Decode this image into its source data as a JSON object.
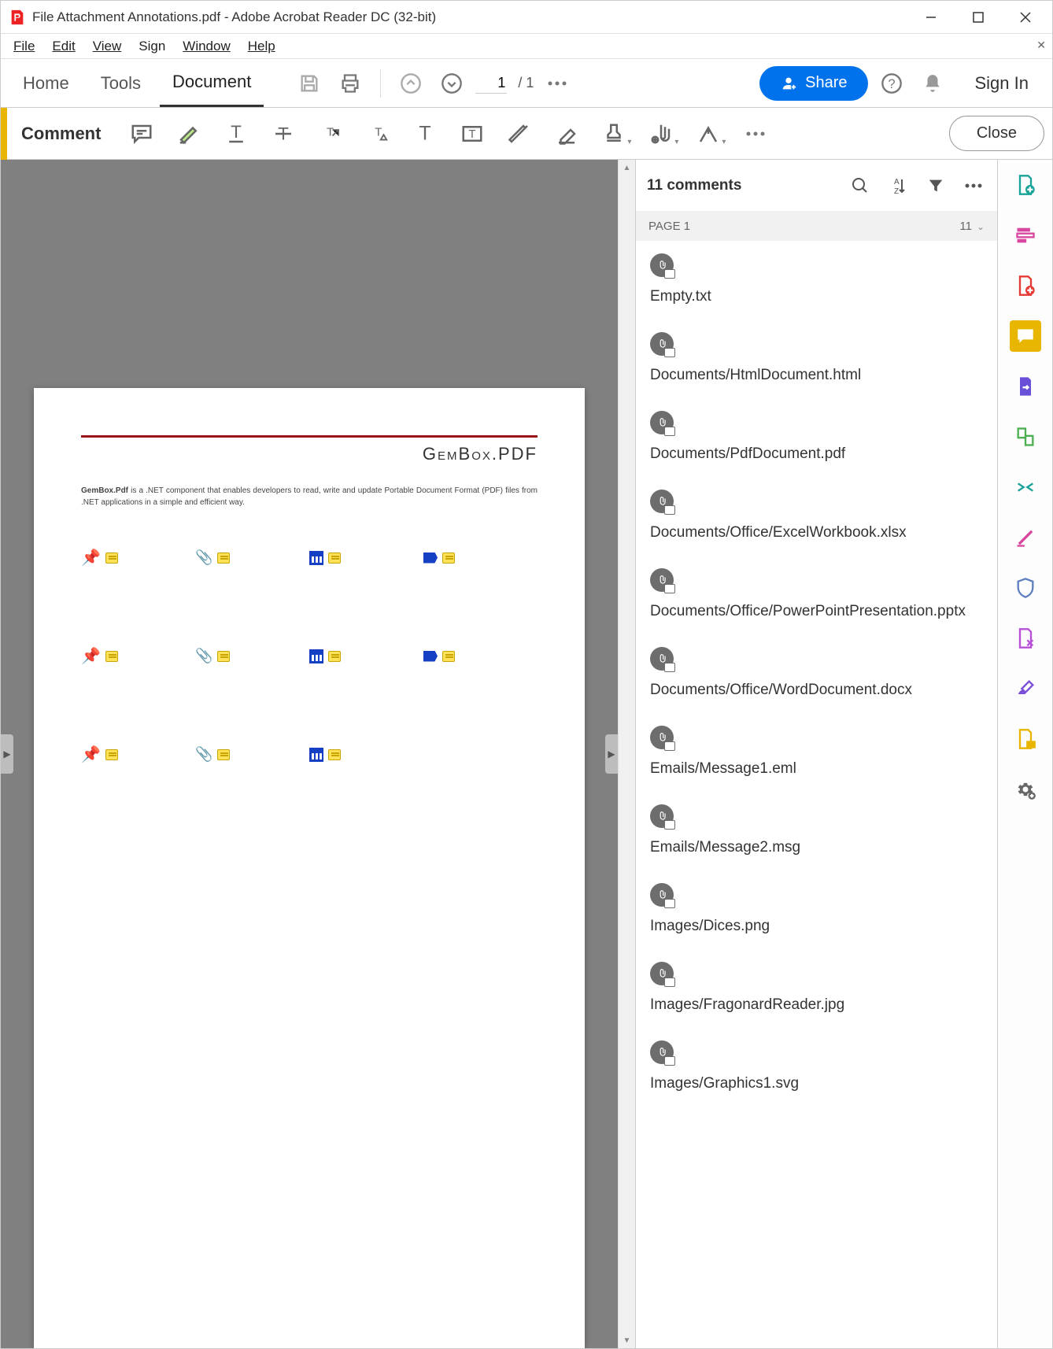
{
  "window": {
    "title": "File Attachment Annotations.pdf - Adobe Acrobat Reader DC (32-bit)"
  },
  "menu": {
    "file": "File",
    "edit": "Edit",
    "view": "View",
    "sign": "Sign",
    "window": "Window",
    "help": "Help"
  },
  "tabs": {
    "home": "Home",
    "tools": "Tools",
    "document": "Document"
  },
  "paging": {
    "current": "1",
    "sep": "/",
    "total": "1"
  },
  "toolbar": {
    "share": "Share",
    "signin": "Sign In"
  },
  "comment_bar": {
    "label": "Comment",
    "close": "Close"
  },
  "comments": {
    "header": "11 comments",
    "page_label": "PAGE 1",
    "page_count": "11",
    "items": [
      "Empty.txt",
      "Documents/HtmlDocument.html",
      "Documents/PdfDocument.pdf",
      "Documents/Office/ExcelWorkbook.xlsx",
      "Documents/Office/PowerPointPresentation.pptx",
      "Documents/Office/WordDocument.docx",
      "Emails/Message1.eml",
      "Emails/Message2.msg",
      "Images/Dices.png",
      "Images/FragonardReader.jpg",
      "Images/Graphics1.svg"
    ]
  },
  "page": {
    "brand": "GemBox.PDF",
    "blurb_bold": "GemBox.Pdf",
    "blurb_rest": " is a .NET component that enables developers to read, write and update Portable Document Format (PDF) files from .NET applications in a simple and efficient way."
  }
}
